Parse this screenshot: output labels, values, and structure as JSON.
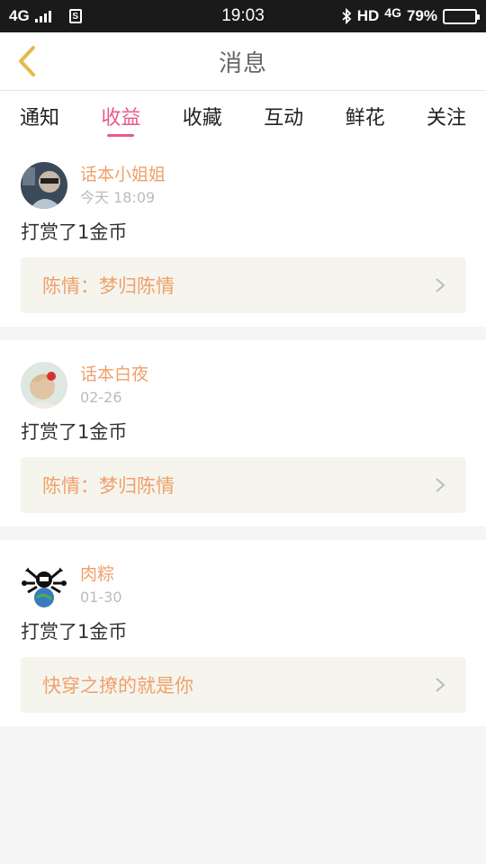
{
  "status_bar": {
    "network": "4G",
    "sim": "S",
    "time": "19:03",
    "hd": "HD",
    "network2": "4G",
    "battery": "79%",
    "battery_level": 0.79
  },
  "header": {
    "title": "消息"
  },
  "tabs": [
    {
      "label": "通知"
    },
    {
      "label": "收益",
      "active": true
    },
    {
      "label": "收藏"
    },
    {
      "label": "互动"
    },
    {
      "label": "鲜花"
    },
    {
      "label": "关注"
    }
  ],
  "messages": [
    {
      "user": "话本小姐姐",
      "time": "今天 18:09",
      "text": "打赏了1金币",
      "book": "陈情：梦归陈情"
    },
    {
      "user": "话本白夜",
      "time": "02-26",
      "text": "打赏了1金币",
      "book": "陈情：梦归陈情"
    },
    {
      "user": "肉粽",
      "time": "01-30",
      "text": "打赏了1金币",
      "book": "快穿之撩的就是你"
    }
  ],
  "colors": {
    "accent": "#e85a8f",
    "username": "#f0a06a",
    "back_arrow": "#e8b84a"
  }
}
